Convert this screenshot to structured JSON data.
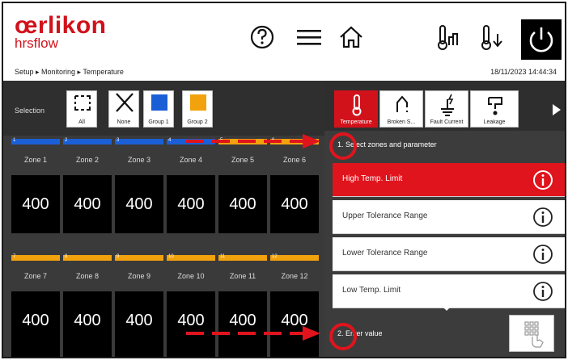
{
  "header": {
    "logo_main": "œrlikon",
    "logo_sub": "hrsflow",
    "breadcrumb": "Setup ▸ Monitoring ▸ Temperature",
    "datetime": "18/11/2023 14:44:34",
    "icons": [
      "help-icon",
      "menu-icon",
      "home-icon",
      "temperature-range-icon",
      "temperature-down-icon",
      "power-icon"
    ]
  },
  "selection": {
    "label": "Selection",
    "buttons": [
      {
        "name": "all",
        "label": "All",
        "icon": "select-all-icon"
      },
      {
        "name": "none",
        "label": "None",
        "icon": "clear-icon"
      },
      {
        "name": "group-1",
        "label": "Group 1",
        "color": "#1a5fd6"
      },
      {
        "name": "group-2",
        "label": "Group 2",
        "color": "#f2a20c"
      }
    ]
  },
  "zones": [
    {
      "num": "1",
      "label": "Zone 1",
      "value": "400",
      "group": "#1a5fd6"
    },
    {
      "num": "2",
      "label": "Zone 2",
      "value": "400",
      "group": "#1a5fd6"
    },
    {
      "num": "3",
      "label": "Zone 3",
      "value": "400",
      "group": "#1a5fd6"
    },
    {
      "num": "4",
      "label": "Zone 4",
      "value": "400",
      "group": "#1a5fd6"
    },
    {
      "num": "5",
      "label": "Zone 5",
      "value": "400",
      "group": "#f2a20c"
    },
    {
      "num": "6",
      "label": "Zone 6",
      "value": "400",
      "group": "#f2a20c"
    },
    {
      "num": "7",
      "label": "Zone 7",
      "value": "400",
      "group": "#f2a20c"
    },
    {
      "num": "8",
      "label": "Zone 8",
      "value": "400",
      "group": "#f2a20c"
    },
    {
      "num": "9",
      "label": "Zone 9",
      "value": "400",
      "group": "#f2a20c"
    },
    {
      "num": "10",
      "label": "Zone 10",
      "value": "400",
      "group": "#f2a20c"
    },
    {
      "num": "11",
      "label": "Zone 11",
      "value": "400",
      "group": "#f2a20c"
    },
    {
      "num": "12",
      "label": "Zone 12",
      "value": "400",
      "group": "#f2a20c"
    }
  ],
  "tabs": [
    {
      "label": "Temperature",
      "icon": "thermometer-icon",
      "active": true
    },
    {
      "label": "Broken S...",
      "icon": "broken-sensor-icon",
      "active": false
    },
    {
      "label": "Fault Current",
      "icon": "fault-current-icon",
      "active": false
    },
    {
      "label": "Leakage",
      "icon": "leakage-icon",
      "active": false
    }
  ],
  "step1": "1. Select zones and parameter",
  "parameters": [
    {
      "label": "High Temp. Limit",
      "active": true
    },
    {
      "label": "Upper Tolerance Range",
      "active": false
    },
    {
      "label": "Lower Tolerance Range",
      "active": false
    },
    {
      "label": "Low Temp. Limit",
      "active": false
    }
  ],
  "step2": "2. Enter value",
  "colors": {
    "brand_red": "#d1121b",
    "active_param": "#e0141d",
    "group1": "#1a5fd6",
    "group2": "#f2a20c",
    "annotation": "#e0141d"
  }
}
